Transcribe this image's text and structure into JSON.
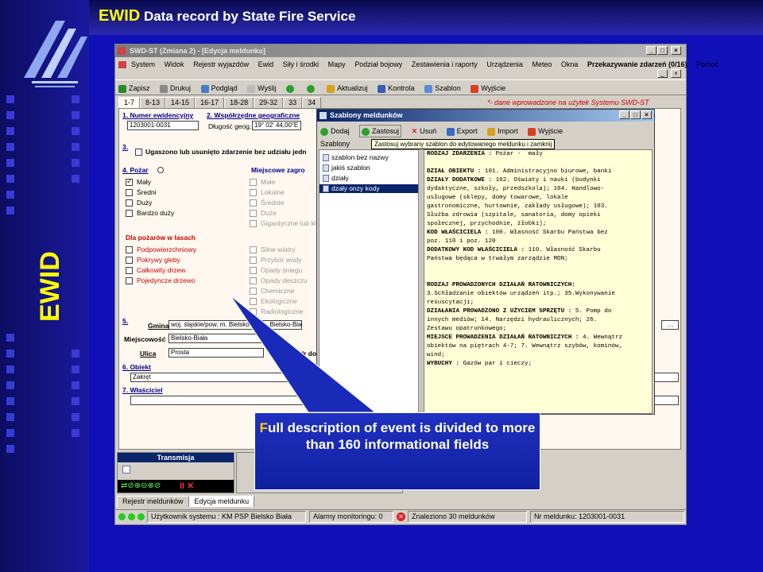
{
  "slide": {
    "title_highlight": "EWID",
    "title_rest": "Data record by State Fire Service",
    "vertical_label": "EWID"
  },
  "window": {
    "title": "SWD-ST (Zmiana 2) - [Edycja meldunku]",
    "menus": [
      "System",
      "Widok",
      "Rejestr wyjazdów",
      "Ewid",
      "Siły i środki",
      "Mapy",
      "Podział bojowy",
      "Zestawienia i raporty",
      "Urządzenia",
      "Meteo",
      "Okna"
    ],
    "menu_right": "Przekazywanie zdarzeń (0/16)",
    "menu_help": "Pomoc",
    "toolbar": [
      "Zapisz",
      "Drukuj",
      "Podgląd",
      "Wyślij",
      "",
      "",
      "Aktualizuj",
      "Kontrola",
      "Szablon",
      "Wyjście"
    ],
    "tabs": [
      "1-7",
      "8-13",
      "14-15",
      "16-17",
      "18-28",
      "29-32",
      "33",
      "34"
    ],
    "note": "*- dane wprowadzone na użytek Systemu SWD-ST",
    "colors": {
      "accent": "#0a246a",
      "note": "#cc0000",
      "form_bg": "#fff8f0"
    }
  },
  "form": {
    "s1_label": "1. Numer ewidencyjny",
    "s1_value": "1203001-0031",
    "s2_label": "2. Współrzędne geograficzne",
    "s2_sub": "Długość geog.",
    "s2_value": "19° 02' 44,00\"E",
    "s3_label": "3.",
    "s3_text": "Ugaszono lub usunięto zdarzenie bez udziału jedn",
    "s4_label": "4. Pożar",
    "pozar_items": [
      "Mały",
      "Średni",
      "Duży",
      "Bardzo duży"
    ],
    "miejscowe_label": "Miejscowe zagro",
    "miejscowe_items": [
      "Małe",
      "Lokalne",
      "Średnie",
      "Duże",
      "Gigantyczne lub klę"
    ],
    "forest_label": "Dla pożarów w lasach",
    "forest_items": [
      "Podpowierzchniowy",
      "Pokrywy gleby",
      "Całkowity drzew",
      "Pojedyncze drzewo"
    ],
    "hazard_items": [
      "Silne wiatry",
      "Przybór wody",
      "Opady śniegu",
      "Opady deszczu",
      "Chemiczne",
      "Ekologiczne",
      "Radiologiczne"
    ],
    "s5_label": "5.",
    "gmina_label": "Gmina",
    "gmina_value": "woj. śląskie/pow. m. Bielsko-B",
    "gmina_value2": "/gm. Bielsko-Biała",
    "miejscowosc_label": "Miejscowość",
    "miejscowosc_value": "Bielsko-Biała",
    "ulica_label": "Ulica",
    "ulica_value": "Prosta",
    "nr_dom_label": "Nr do",
    "s6_label": "6. Obiekt",
    "s6_value": "Zakręt",
    "s7_label": "7. Właściciel"
  },
  "dialog": {
    "title": "Szablony meldunków",
    "toolbar": [
      "Dodaj",
      "Zastosuj",
      "Usuń",
      "Export",
      "Import",
      "Wyjście"
    ],
    "list_header": "Szablony",
    "tooltip": "Zastosuj wybrany szablon do edytowanego meldunku i zamknij",
    "list": [
      "szablon bez nazwy",
      "jakiś szablon",
      "działy",
      "dzały onzy kody"
    ],
    "text_lines": [
      "RODZAJ ZDARZENIA : Pożar -  mały",
      "",
      "DZIAŁ OBIEKTU : 101. Administracyjno biurowe, banki",
      "DZIAŁY DODATKOWE : 102. Oświaty i nauki (budynki",
      "dydaktyczne, szkoły, przedszkola); 104. Handlowo-",
      "usługowe (sklepy, domy towarowe, lokale",
      "gastronomiczne, hurtownie, zakłady usługowe); 103.",
      "Służba zdrowia (szpitale, sanatoria, domy opieki",
      "społecznej, przychodnie, żłobki);",
      "KOD WŁAŚCICIELA : 100. Własność Skarbu Państwa bez",
      "poz. 110 i poz. 120",
      "DODATKOWY KOD WŁAŚCICIELA : 110. Własność Skarbu",
      "Państwa będąca w trwałym zarządzie MON;",
      "",
      "",
      "RODZAJ PROWADZONYCH DZIAŁAŃ RATOWNICZYCH:",
      "3.Schładzanie obiektów urządzeń itp.; 35.Wykonywanie",
      "resuscytacji;",
      "DZIAŁANIA PROWADZONO Z UŻYCIEM SPRZĘTU : 5. Pomp do",
      "innych mediów; 14. Narzędzi hydraulicznych; 26.",
      "Zestawu opatrunkowego;",
      "MIEJSCE PROWADZENIA DZIAŁAŃ RATOWNICZYCH : 4. Wewnątrz",
      "obiektów na piętrach 4-7; 7. Wewnątrz szybów, kominów,",
      "wind;",
      "WYBUCHY : Gazów par i cieczy;"
    ]
  },
  "bottom": {
    "panel_title": "Transmisja",
    "bottom_tabs": [
      "Rejestr meldunków",
      "Edycja meldunku"
    ],
    "status_user": "Użytkownik systemu : KM PSP Bielsko Biała",
    "status_alarms": "Alarmy monitoringu: 0",
    "status_found": "Znaleziono 30 meldunków",
    "status_nr": "Nr meldunku: 1203001-0031"
  },
  "callout": {
    "first_letter": "F",
    "rest": "ull description of event is divided to more than 160 informational fields"
  }
}
